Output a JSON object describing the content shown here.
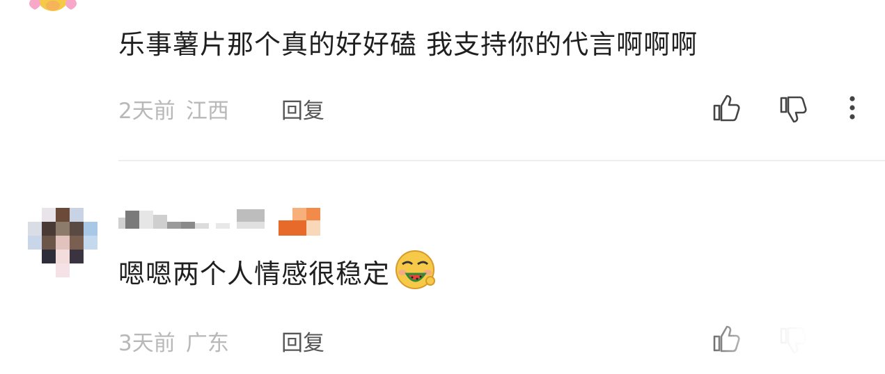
{
  "comments": [
    {
      "text": "乐事薯片那个真的好好磕 我支持你的代言啊啊啊",
      "time": "2天前",
      "location": "江西",
      "reply_label": "回复"
    },
    {
      "text": "嗯嗯两个人情感很稳定",
      "time": "3天前",
      "location": "广东",
      "reply_label": "回复"
    }
  ],
  "icons": {
    "like": "thumbs-up-icon",
    "dislike": "thumbs-down-icon",
    "more": "more-vertical-icon",
    "emoji_blush": "blushing-hands-emoji-icon",
    "emoji_watermelon": "eating-watermelon-emoji-icon"
  },
  "colors": {
    "text": "#1f1f1f",
    "meta": "#b8b8b8",
    "reply": "#555555",
    "divider": "#eeeeee",
    "icon": "#444444"
  }
}
